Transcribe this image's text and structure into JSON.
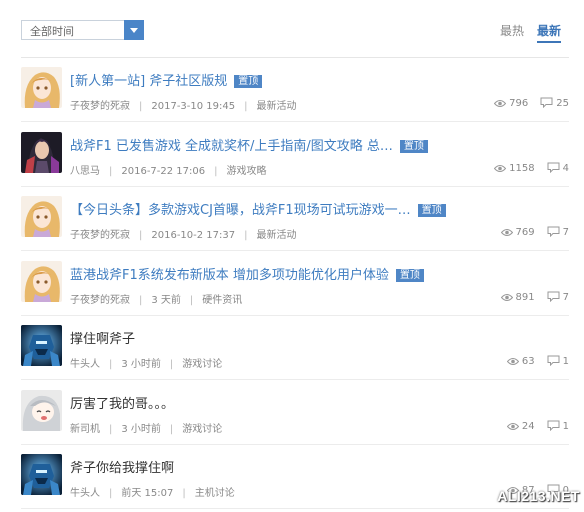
{
  "filter": {
    "selected": "全部时间"
  },
  "sort": {
    "hot_label": "最热",
    "new_label": "最新"
  },
  "badge_label": "置顶",
  "posts": [
    {
      "title": "[新人第一站] 斧子社区版规",
      "author": "子夜梦的死寂",
      "time": "2017-3-10 19:45",
      "category": "最新活动",
      "views": "796",
      "comments": "25",
      "pinned": true,
      "avatar": "anime-girl"
    },
    {
      "title": "战斧F1 已发售游戏 全成就奖杯/上手指南/图文攻略 总…",
      "author": "八思马",
      "time": "2016-7-22 17:06",
      "category": "游戏攻略",
      "views": "1158",
      "comments": "4",
      "pinned": true,
      "avatar": "dark-warrior"
    },
    {
      "title": "【今日头条】多款游戏CJ首曝，战斧F1现场可试玩游戏一…",
      "author": "子夜梦的死寂",
      "time": "2016-10-2 17:37",
      "category": "最新活动",
      "views": "769",
      "comments": "7",
      "pinned": true,
      "avatar": "anime-girl"
    },
    {
      "title": "蓝港战斧F1系统发布新版本 增加多项功能优化用户体验",
      "author": "子夜梦的死寂",
      "time": "3 天前",
      "category": "硬件资讯",
      "views": "891",
      "comments": "7",
      "pinned": true,
      "avatar": "anime-girl"
    },
    {
      "title": "撑住啊斧子",
      "author": "牛头人",
      "time": "3 小时前",
      "category": "游戏讨论",
      "views": "63",
      "comments": "1",
      "pinned": false,
      "avatar": "blue-robot"
    },
    {
      "title": "厉害了我的哥。。。",
      "author": "新司机",
      "time": "3 小时前",
      "category": "游戏讨论",
      "views": "24",
      "comments": "1",
      "pinned": false,
      "avatar": "cartoon-girl"
    },
    {
      "title": "斧子你给我撑住啊",
      "author": "牛头人",
      "time": "前天 15:07",
      "category": "主机讨论",
      "views": "87",
      "comments": "0",
      "pinned": false,
      "avatar": "blue-robot"
    }
  ],
  "watermark": "ALI213.NET",
  "colors": {
    "accent": "#3e7cc0",
    "badge": "#4f86c6",
    "muted": "#888888"
  }
}
